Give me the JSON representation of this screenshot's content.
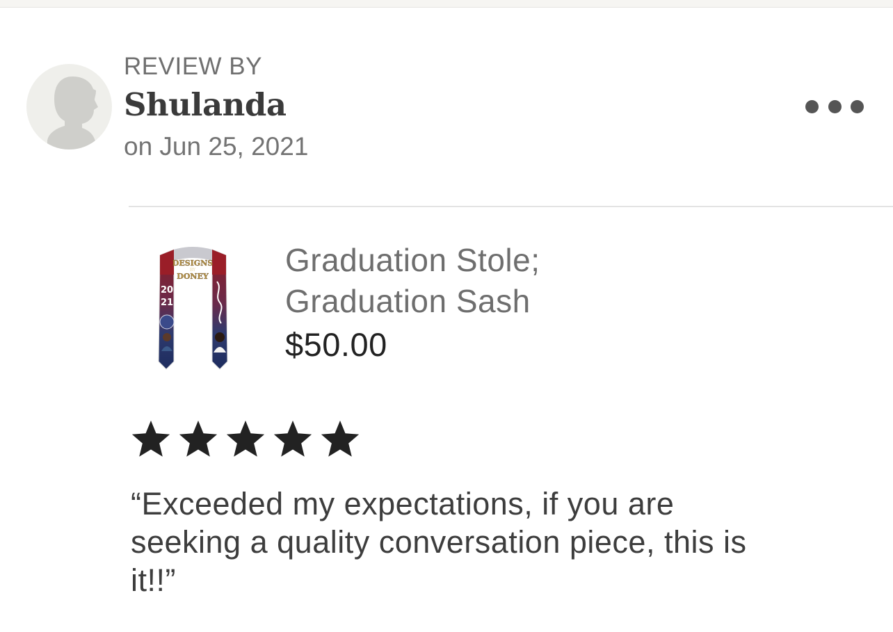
{
  "review": {
    "heading": "REVIEW BY",
    "reviewer_name": "Shulanda",
    "date": "on Jun 25, 2021",
    "more_icon": "more-options-icon",
    "avatar_icon": "default-avatar-icon",
    "rating": 5,
    "rating_max": 5,
    "star_icon": "star-icon",
    "text_lines": [
      "“Exceeded my expectations, if you are",
      "seeking a quality conversation piece, this is",
      "it!!”"
    ]
  },
  "product": {
    "title_lines": [
      "Graduation Stole;",
      "Graduation Sash"
    ],
    "price": "$50.00",
    "image_logo_text": [
      "DESIGNS",
      "BY",
      "DONEY"
    ],
    "image_year": [
      "20",
      "21"
    ]
  },
  "colors": {
    "star": "#222222",
    "stole_red": "#8c1c24",
    "stole_navy": "#1d2c5e",
    "logo_gold": "#b8954a"
  }
}
